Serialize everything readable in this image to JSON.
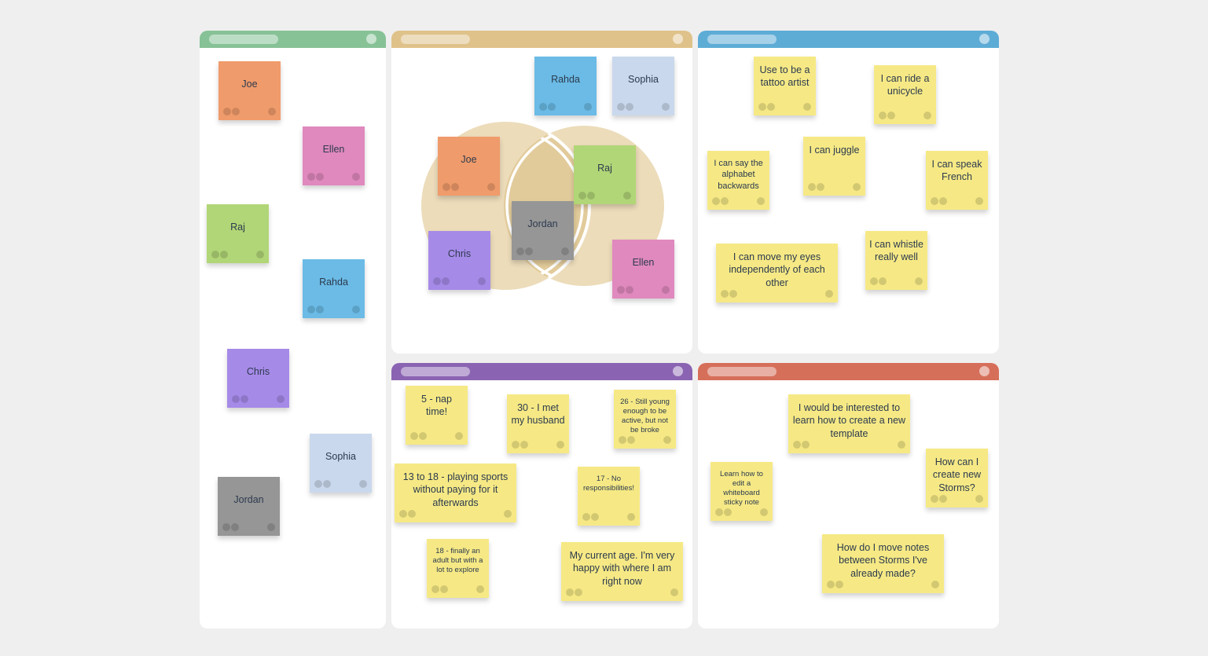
{
  "colors": {
    "background": "#efefef",
    "green_header": "#86c296",
    "tan_header": "#dfc28a",
    "blue_header": "#5dacd6",
    "purple_header": "#8a64b2",
    "red_header": "#d66f5a",
    "note_orange": "#f09b6b",
    "note_pink": "#e089be",
    "note_green": "#b1d677",
    "note_blue": "#6bbbe6",
    "note_purple": "#a68ae8",
    "note_lightblue": "#c9d8ec",
    "note_gray": "#969696",
    "note_yellow": "#f6e985",
    "venn_fill": "#ecdcba",
    "venn_overlap": "#e2cb9b"
  },
  "panels": {
    "names": {
      "title": "",
      "notes": [
        {
          "text": "Joe",
          "color": "orange"
        },
        {
          "text": "Ellen",
          "color": "pink"
        },
        {
          "text": "Raj",
          "color": "green"
        },
        {
          "text": "Rahda",
          "color": "blue"
        },
        {
          "text": "Chris",
          "color": "purple"
        },
        {
          "text": "Sophia",
          "color": "lightblue"
        },
        {
          "text": "Jordan",
          "color": "gray"
        }
      ]
    },
    "venn": {
      "notes": [
        {
          "text": "Rahda",
          "color": "blue"
        },
        {
          "text": "Sophia",
          "color": "lightblue"
        },
        {
          "text": "Joe",
          "color": "orange"
        },
        {
          "text": "Raj",
          "color": "green"
        },
        {
          "text": "Jordan",
          "color": "gray"
        },
        {
          "text": "Chris",
          "color": "purple"
        },
        {
          "text": "Ellen",
          "color": "pink"
        }
      ]
    },
    "fun_facts": {
      "notes": [
        {
          "text": "Use to be a tattoo artist"
        },
        {
          "text": "I can ride a unicycle"
        },
        {
          "text": "I can say the alphabet backwards"
        },
        {
          "text": "I can juggle"
        },
        {
          "text": "I can speak French"
        },
        {
          "text": "I can move my eyes independently of each other"
        },
        {
          "text": "I can whistle really well"
        }
      ]
    },
    "favorite_age": {
      "notes": [
        {
          "text": "5 - nap time!"
        },
        {
          "text": "30 - I met my husband"
        },
        {
          "text": "26 - Still young enough to be active, but not be broke"
        },
        {
          "text": "13 to 18 - playing sports without paying for it afterwards"
        },
        {
          "text": "17 - No responsibilities!"
        },
        {
          "text": "18 - finally an adult but with a lot to explore"
        },
        {
          "text": "My current age. I'm very happy with where I am right now"
        }
      ]
    },
    "questions": {
      "notes": [
        {
          "text": "I would be interested to learn how to create a new template"
        },
        {
          "text": "Learn how to edit a whiteboard sticky note"
        },
        {
          "text": "How can I create new Storms?"
        },
        {
          "text": "How do I move notes between Storms I've already made?"
        }
      ]
    }
  }
}
